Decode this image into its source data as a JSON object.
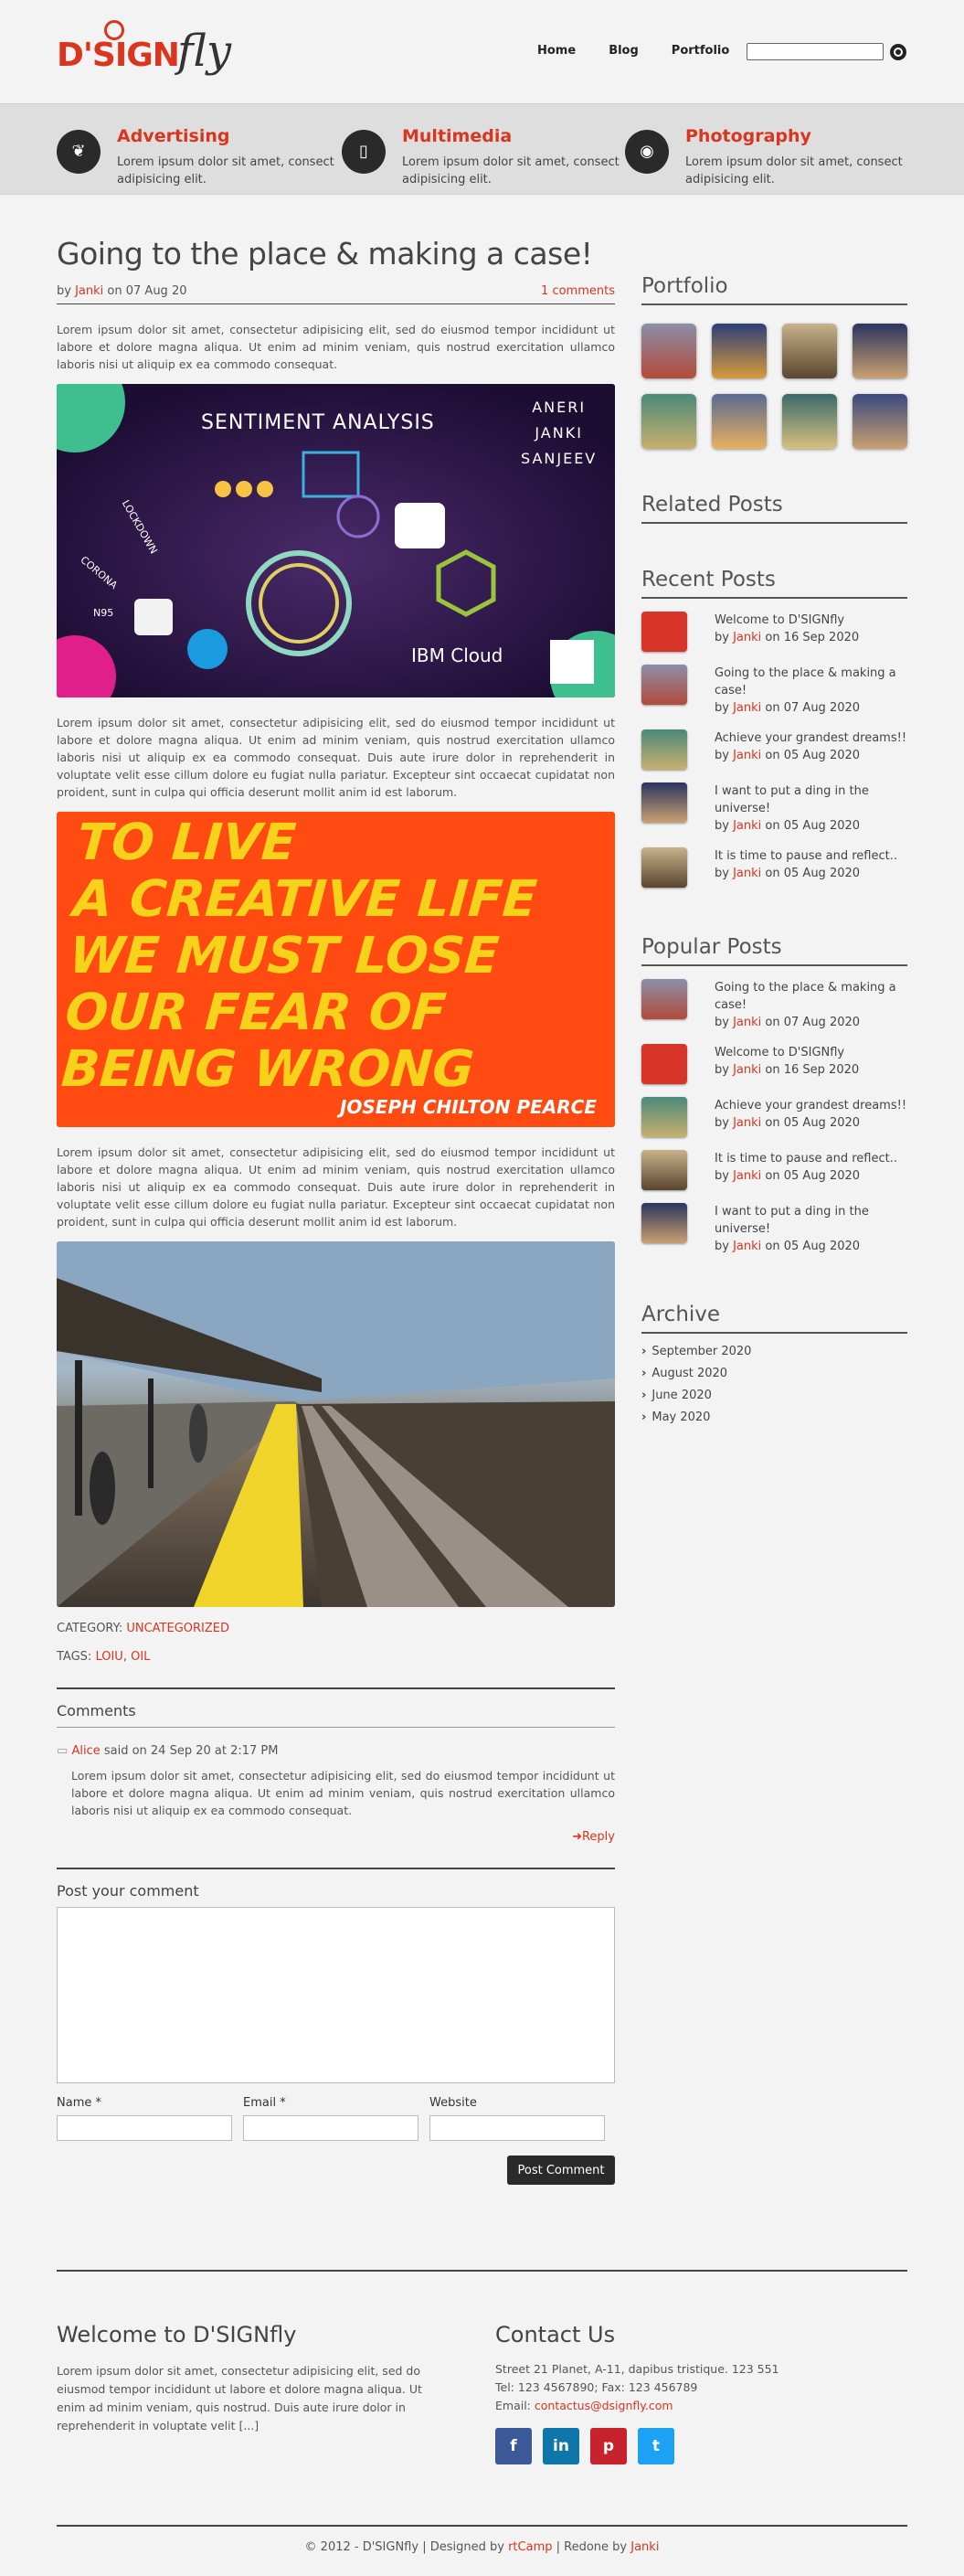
{
  "logo": {
    "main_left": "D'SIGN",
    "main_right": "fly"
  },
  "nav": {
    "items": [
      "Home",
      "Blog",
      "Portfolio"
    ]
  },
  "features": [
    {
      "title": "Advertising",
      "text": "Lorem ipsum dolor sit amet, consect adipisicing elit.",
      "icon": "leaf-icon"
    },
    {
      "title": "Multimedia",
      "text": "Lorem ipsum dolor sit amet, consect adipisicing elit.",
      "icon": "phone-icon"
    },
    {
      "title": "Photography",
      "text": "Lorem ipsum dolor sit amet, consect adipisicing elit.",
      "icon": "camera-icon"
    }
  ],
  "post": {
    "title": "Going to the place & making a case!",
    "by": "by",
    "author": "Janki",
    "on": "on 07 Aug 20",
    "comments_link": "1 comments",
    "para1": "Lorem ipsum dolor sit amet, consectetur adipisicing elit, sed do eiusmod tempor incididunt ut labore et dolore magna aliqua. Ut enim ad minim veniam, quis nostrud exercitation ullamco laboris nisi ut aliquip ex ea commodo consequat.",
    "para2": "Lorem ipsum dolor sit amet, consectetur adipisicing elit, sed do eiusmod tempor incididunt ut labore et dolore magna aliqua. Ut enim ad minim veniam, quis nostrud exercitation ullamco laboris nisi ut aliquip ex ea commodo consequat. Duis aute irure dolor in reprehenderit in voluptate velit esse cillum dolore eu fugiat nulla pariatur. Excepteur sint occaecat cupidatat non proident, sunt in culpa qui officia deserunt mollit anim id est laborum.",
    "para3": "Lorem ipsum dolor sit amet, consectetur adipisicing elit, sed do eiusmod tempor incididunt ut labore et dolore magna aliqua. Ut enim ad minim veniam, quis nostrud exercitation ullamco laboris nisi ut aliquip ex ea commodo consequat. Duis aute irure dolor in reprehenderit in voluptate velit esse cillum dolore eu fugiat nulla pariatur. Excepteur sint occaecat cupidatat non proident, sunt in culpa qui officia deserunt mollit anim id est laborum.",
    "img1": {
      "heading": "SENTIMENT ANALYSIS",
      "names": [
        "ANERI",
        "JANKI",
        "SANJEEV"
      ],
      "tags": [
        "LOCKDOWN",
        "CORONA",
        "N95"
      ],
      "brand": "IBM Cloud"
    },
    "img2": {
      "lines": [
        "TO LIVE",
        "A CREATIVE LIFE",
        "WE MUST LOSE",
        "OUR FEAR OF",
        "BEING WRONG"
      ],
      "author": "JOSEPH CHILTON PEARCE"
    },
    "category_label": "CATEGORY:",
    "category": "UNCATEGORIZED",
    "tags_label": "TAGS:",
    "tags": [
      "LOIU",
      "OIL"
    ]
  },
  "comments": {
    "heading": "Comments",
    "author": "Alice",
    "said": "said on 24 Sep 20 at 2:17 PM",
    "body": "Lorem ipsum dolor sit amet, consectetur adipisicing elit, sed do eiusmod tempor incididunt ut labore et dolore magna aliqua. Ut enim ad minim veniam, quis nostrud exercitation ullamco laboris nisi ut aliquip ex ea commodo consequat.",
    "reply": "Reply"
  },
  "form": {
    "heading": "Post your comment",
    "name": "Name *",
    "email": "Email *",
    "website": "Website",
    "submit": "Post Comment"
  },
  "sidebar": {
    "portfolio": "Portfolio",
    "related": "Related Posts",
    "recent": "Recent Posts",
    "popular": "Popular Posts",
    "archive": "Archive",
    "recent_posts": [
      {
        "title": "Welcome to D'SIGNfly",
        "author": "Janki",
        "date": "on 16 Sep 2020"
      },
      {
        "title": "Going to the place & making a case!",
        "author": "Janki",
        "date": "on 07 Aug 2020"
      },
      {
        "title": "Achieve your grandest dreams!!",
        "author": "Janki",
        "date": "on 05 Aug 2020"
      },
      {
        "title": "I want to put a ding in the universe!",
        "author": "Janki",
        "date": "on 05 Aug 2020"
      },
      {
        "title": "It is time to pause and reflect..",
        "author": "Janki",
        "date": "on 05 Aug 2020"
      }
    ],
    "popular_posts": [
      {
        "title": "Going to the place & making a case!",
        "author": "Janki",
        "date": "on 07 Aug 2020"
      },
      {
        "title": "Welcome to D'SIGNfly",
        "author": "Janki",
        "date": "on 16 Sep 2020"
      },
      {
        "title": "Achieve your grandest dreams!!",
        "author": "Janki",
        "date": "on 05 Aug 2020"
      },
      {
        "title": "It is time to pause and reflect..",
        "author": "Janki",
        "date": "on 05 Aug 2020"
      },
      {
        "title": "I want to put a ding in the universe!",
        "author": "Janki",
        "date": "on 05 Aug 2020"
      }
    ],
    "archive_items": [
      "September 2020",
      "August 2020",
      "June 2020",
      "May 2020"
    ],
    "by": "by"
  },
  "footer": {
    "welcome_title": "Welcome to D'SIGNfly",
    "welcome_text": "Lorem ipsum dolor sit amet, consectetur adipisicing elit, sed do eiusmod tempor incididunt ut labore et dolore magna aliqua. Ut enim ad minim veniam, quis nostrud. Duis aute irure dolor in reprehenderit in voluptate velit [...]",
    "contact_title": "Contact Us",
    "address": "Street 21 Planet, A-11, dapibus tristique. 123 551",
    "phone": "Tel: 123 4567890; Fax: 123 456789",
    "email_label": "Email:",
    "email": "contactus@dsignfly.com",
    "social": [
      "f",
      "in",
      "p",
      "t"
    ],
    "copy_prefix": "© 2012 - D'SIGNfly | Designed by",
    "rtcamp": "rtCamp",
    "redone": "| Redone by",
    "redone_by": "Janki"
  },
  "colors": {
    "accent": "#d9351f",
    "dark": "#2a2a2a",
    "facebook": "#3b5998",
    "linkedin": "#0e76a8",
    "pinterest": "#c8232c",
    "twitter": "#1da1f2"
  }
}
